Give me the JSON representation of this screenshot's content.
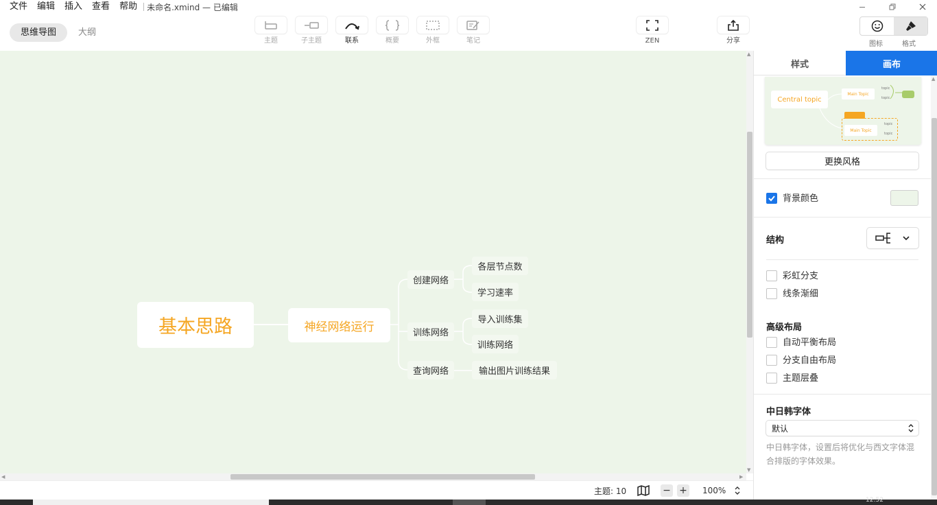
{
  "menu": {
    "items": [
      "文件",
      "编辑",
      "插入",
      "查看",
      "帮助"
    ],
    "document_title": "未命名.xmind — 已编辑"
  },
  "view_switch": {
    "mindmap": "思维导图",
    "outline": "大纲"
  },
  "toolbar": {
    "topic": "主题",
    "subtopic": "子主题",
    "relationship": "联系",
    "summary": "概要",
    "boundary": "外框",
    "note": "笔记",
    "zen": "ZEN",
    "share": "分享",
    "icon_panel": "图标",
    "format_panel": "格式"
  },
  "mindmap": {
    "central": "基本思路",
    "main": "神经网络运行",
    "branches": [
      {
        "label": "创建网络",
        "children": [
          "各层节点数",
          "学习速率"
        ]
      },
      {
        "label": "训练网络",
        "children": [
          "导入训练集",
          "训练网络"
        ]
      },
      {
        "label": "查询网络",
        "children": [
          "输出图片训练结果"
        ]
      }
    ]
  },
  "status": {
    "topic_count": "主题: 10",
    "zoom_out": "−",
    "zoom_in": "+",
    "zoom": "100%"
  },
  "panel": {
    "tabs": [
      "样式",
      "画布"
    ],
    "active_tab": "画布",
    "preview": {
      "central": "Central topic",
      "main1": "Main Topic",
      "main2": "Main Topic",
      "topic": "topic"
    },
    "change_style": "更换风格",
    "background_color": {
      "label": "背景颜色",
      "checked": true,
      "color": "#edf5e9"
    },
    "structure_title": "结构",
    "rainbow_branch": "彩虹分支",
    "tapered_lines": "线条渐细",
    "advanced_layout": "高级布局",
    "auto_balance": "自动平衡布局",
    "free_branch": "分支自由布局",
    "topic_overlap": "主题层叠",
    "cjk_font_title": "中日韩字体",
    "cjk_font_value": "默认",
    "cjk_font_desc": "中日韩字体，设置后将优化与西文字体混合排版的字体效果。"
  },
  "taskbar": {
    "clock": "12:52"
  },
  "colors": {
    "accent": "#1a75e8",
    "topic_orange": "#f5a623",
    "canvas_bg": "#edf5e9",
    "preview_green": "#a8cc6a"
  }
}
